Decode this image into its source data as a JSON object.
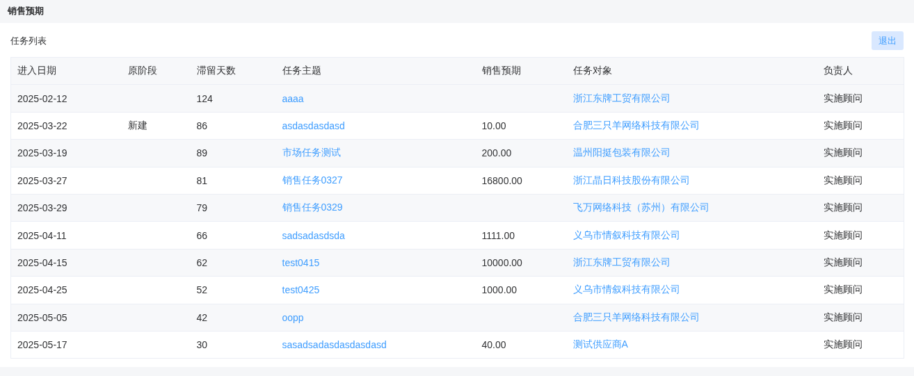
{
  "page_title": "销售预期",
  "list_title": "任务列表",
  "exit_button": "退出",
  "table": {
    "columns": [
      {
        "label": "进入日期",
        "kind": "text"
      },
      {
        "label": "原阶段",
        "kind": "text"
      },
      {
        "label": "滞留天数",
        "kind": "text"
      },
      {
        "label": "任务主题",
        "kind": "link"
      },
      {
        "label": "销售预期",
        "kind": "text"
      },
      {
        "label": "任务对象",
        "kind": "link"
      },
      {
        "label": "负责人",
        "kind": "text"
      }
    ],
    "rows": [
      {
        "cells": [
          "2025-02-12",
          null,
          "124",
          "aaaa",
          null,
          "浙江东牌工贸有限公司",
          "实施顾问"
        ]
      },
      {
        "cells": [
          "2025-03-22",
          "新建",
          "86",
          "asdasdasdasd",
          "10.00",
          "合肥三只羊网络科技有限公司",
          "实施顾问"
        ]
      },
      {
        "cells": [
          "2025-03-19",
          null,
          "89",
          "市场任务测试",
          "200.00",
          "温州阳挺包装有限公司",
          "实施顾问"
        ]
      },
      {
        "cells": [
          "2025-03-27",
          null,
          "81",
          "销售任务0327",
          "16800.00",
          "浙江晶日科技股份有限公司",
          "实施顾问"
        ]
      },
      {
        "cells": [
          "2025-03-29",
          null,
          "79",
          "销售任务0329",
          null,
          "飞万网络科技（苏州）有限公司",
          "实施顾问"
        ]
      },
      {
        "cells": [
          "2025-04-11",
          null,
          "66",
          "sadsadasdsda",
          "1111.00",
          "义乌市情叙科技有限公司",
          "实施顾问"
        ]
      },
      {
        "cells": [
          "2025-04-15",
          null,
          "62",
          "test0415",
          "10000.00",
          "浙江东牌工贸有限公司",
          "实施顾问"
        ]
      },
      {
        "cells": [
          "2025-04-25",
          null,
          "52",
          "test0425",
          "1000.00",
          "义乌市情叙科技有限公司",
          "实施顾问"
        ]
      },
      {
        "cells": [
          "2025-05-05",
          null,
          "42",
          "oopp",
          null,
          "合肥三只羊网络科技有限公司",
          "实施顾问"
        ]
      },
      {
        "cells": [
          "2025-05-17",
          null,
          "30",
          "sasadsadasdasdasdasd",
          "40.00",
          "测试供应商A",
          "实施顾问"
        ]
      }
    ]
  }
}
